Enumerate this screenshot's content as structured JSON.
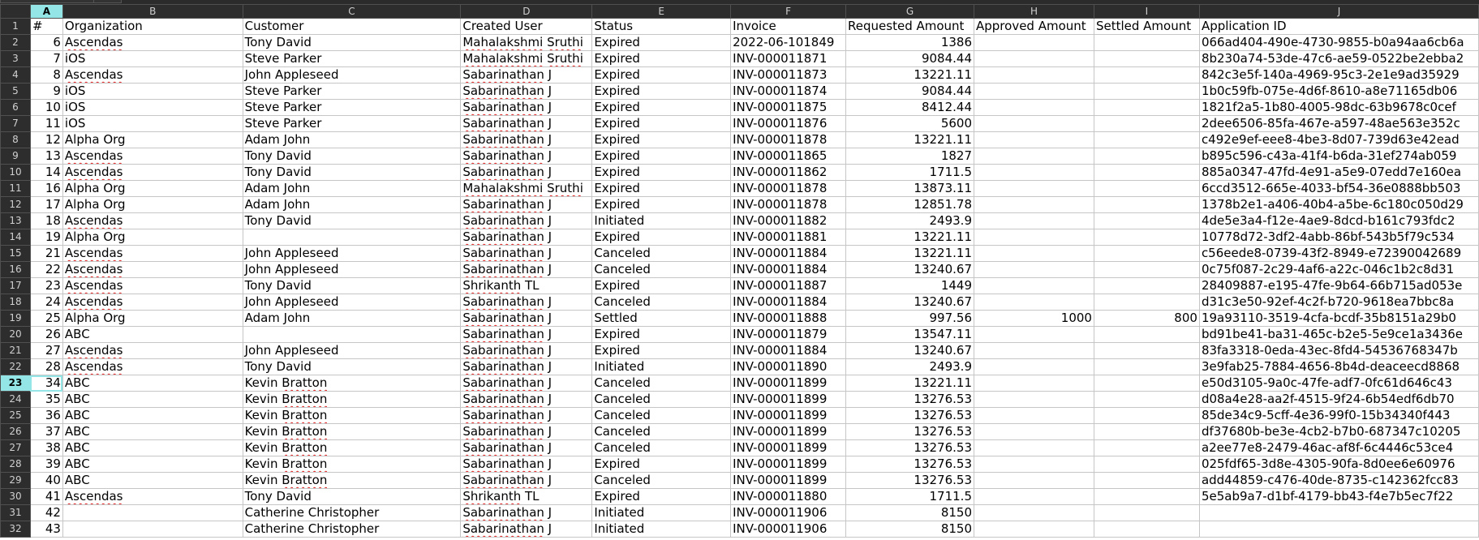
{
  "sheet": {
    "column_letters": [
      "A",
      "B",
      "C",
      "D",
      "E",
      "F",
      "G",
      "H",
      "I",
      "J"
    ],
    "selected_column": "A",
    "selected_row": 23,
    "accent_color": "#94e6e6",
    "headers": [
      "#",
      "Organization",
      "Customer",
      "Created User",
      "Status",
      "Invoice",
      "Requested Amount",
      "Approved Amount",
      "Settled Amount",
      "Application ID"
    ],
    "rows": [
      [
        "6",
        "Ascendas",
        "Tony David",
        "Mahalakshmi Sruthi",
        "Expired",
        "2022-06-101849",
        "1386",
        "",
        "",
        "066ad404-490e-4730-9855-b0a94aa6cb6a"
      ],
      [
        "7",
        "iOS",
        "Steve Parker",
        "Mahalakshmi Sruthi",
        "Expired",
        "INV-000011871",
        "9084.44",
        "",
        "",
        "8b230a74-53de-47c6-ae59-0522be2ebba2"
      ],
      [
        "8",
        "Ascendas",
        "John Appleseed",
        "Sabarinathan J",
        "Expired",
        "INV-000011873",
        "13221.11",
        "",
        "",
        "842c3e5f-140a-4969-95c3-2e1e9ad35929"
      ],
      [
        "9",
        "iOS",
        "Steve Parker",
        "Sabarinathan J",
        "Expired",
        "INV-000011874",
        "9084.44",
        "",
        "",
        "1b0c59fb-075e-4d6f-8610-a8e71165db06"
      ],
      [
        "10",
        "iOS",
        "Steve Parker",
        "Sabarinathan J",
        "Expired",
        "INV-000011875",
        "8412.44",
        "",
        "",
        "1821f2a5-1b80-4005-98dc-63b9678c0cef"
      ],
      [
        "11",
        "iOS",
        "Steve Parker",
        "Sabarinathan J",
        "Expired",
        "INV-000011876",
        "5600",
        "",
        "",
        "2dee6506-85fa-467e-a597-48ae563e352c"
      ],
      [
        "12",
        "Alpha Org",
        "Adam John",
        "Sabarinathan J",
        "Expired",
        "INV-000011878",
        "13221.11",
        "",
        "",
        "c492e9ef-eee8-4be3-8d07-739d63e42ead"
      ],
      [
        "13",
        "Ascendas",
        "Tony David",
        "Sabarinathan J",
        "Expired",
        "INV-000011865",
        "1827",
        "",
        "",
        "b895c596-c43a-41f4-b6da-31ef274ab059"
      ],
      [
        "14",
        "Ascendas",
        "Tony David",
        "Sabarinathan J",
        "Expired",
        "INV-000011862",
        "1711.5",
        "",
        "",
        "885a0347-47fd-4e91-a5e9-07edd7e160ea"
      ],
      [
        "16",
        "Alpha Org",
        "Adam John",
        "Mahalakshmi Sruthi",
        "Expired",
        "INV-000011878",
        "13873.11",
        "",
        "",
        "6ccd3512-665e-4033-bf54-36e0888bb503"
      ],
      [
        "17",
        "Alpha Org",
        "Adam John",
        "Sabarinathan J",
        "Expired",
        "INV-000011878",
        "12851.78",
        "",
        "",
        "1378b2e1-a406-40b4-a5be-6c180c050d29"
      ],
      [
        "18",
        "Ascendas",
        "Tony David",
        "Sabarinathan J",
        "Initiated",
        "INV-000011882",
        "2493.9",
        "",
        "",
        "4de5e3a4-f12e-4ae9-8dcd-b161c793fdc2"
      ],
      [
        "19",
        "Alpha Org",
        "",
        "Sabarinathan J",
        "Expired",
        "INV-000011881",
        "13221.11",
        "",
        "",
        "10778d72-3df2-4abb-86bf-543b5f79c534"
      ],
      [
        "21",
        "Ascendas",
        "John Appleseed",
        "Sabarinathan J",
        "Canceled",
        "INV-000011884",
        "13221.11",
        "",
        "",
        "c56eede8-0739-43f2-8949-e72390042689"
      ],
      [
        "22",
        "Ascendas",
        "John Appleseed",
        "Sabarinathan J",
        "Canceled",
        "INV-000011884",
        "13240.67",
        "",
        "",
        "0c75f087-2c29-4af6-a22c-046c1b2c8d31"
      ],
      [
        "23",
        "Ascendas",
        "Tony David",
        "Shrikanth TL",
        "Expired",
        "INV-000011887",
        "1449",
        "",
        "",
        "28409887-e195-47fe-9b64-66b715ad053e"
      ],
      [
        "24",
        "Ascendas",
        "John Appleseed",
        "Sabarinathan J",
        "Canceled",
        "INV-000011884",
        "13240.67",
        "",
        "",
        "d31c3e50-92ef-4c2f-b720-9618ea7bbc8a"
      ],
      [
        "25",
        "Alpha Org",
        "Adam John",
        "Sabarinathan J",
        "Settled",
        "INV-000011888",
        "997.56",
        "1000",
        "800",
        "19a93110-3519-4cfa-bcdf-35b8151a29b0"
      ],
      [
        "26",
        "ABC",
        "",
        "Sabarinathan J",
        "Expired",
        "INV-000011879",
        "13547.11",
        "",
        "",
        "bd91be41-ba31-465c-b2e5-5e9ce1a3436e"
      ],
      [
        "27",
        "Ascendas",
        "John Appleseed",
        "Sabarinathan J",
        "Expired",
        "INV-000011884",
        "13240.67",
        "",
        "",
        "83fa3318-0eda-43ec-8fd4-54536768347b"
      ],
      [
        "28",
        "Ascendas",
        "Tony David",
        "Sabarinathan J",
        "Initiated",
        "INV-000011890",
        "2493.9",
        "",
        "",
        "3e9fab25-7884-4656-8b4d-deaceecd8868"
      ],
      [
        "34",
        "ABC",
        "Kevin Bratton",
        "Sabarinathan J",
        "Canceled",
        "INV-000011899",
        "13221.11",
        "",
        "",
        "e50d3105-9a0c-47fe-adf7-0fc61d646c43"
      ],
      [
        "35",
        "ABC",
        "Kevin Bratton",
        "Sabarinathan J",
        "Canceled",
        "INV-000011899",
        "13276.53",
        "",
        "",
        "d08a4e28-aa2f-4515-9f24-6b54edf6db70"
      ],
      [
        "36",
        "ABC",
        "Kevin Bratton",
        "Sabarinathan J",
        "Canceled",
        "INV-000011899",
        "13276.53",
        "",
        "",
        "85de34c9-5cff-4e36-99f0-15b34340f443"
      ],
      [
        "37",
        "ABC",
        "Kevin Bratton",
        "Sabarinathan J",
        "Canceled",
        "INV-000011899",
        "13276.53",
        "",
        "",
        "df37680b-be3e-4cb2-b7b0-687347c10205"
      ],
      [
        "38",
        "ABC",
        "Kevin Bratton",
        "Sabarinathan J",
        "Canceled",
        "INV-000011899",
        "13276.53",
        "",
        "",
        "a2ee77e8-2479-46ac-af8f-6c4446c53ce4"
      ],
      [
        "39",
        "ABC",
        "Kevin Bratton",
        "Sabarinathan J",
        "Expired",
        "INV-000011899",
        "13276.53",
        "",
        "",
        "025fdf65-3d8e-4305-90fa-8d0ee6e60976"
      ],
      [
        "40",
        "ABC",
        "Kevin Bratton",
        "Sabarinathan J",
        "Canceled",
        "INV-000011899",
        "13276.53",
        "",
        "",
        "add44859-c476-40de-8735-c142362fcc83"
      ],
      [
        "41",
        "Ascendas",
        "Tony David",
        "Shrikanth TL",
        "Expired",
        "INV-000011880",
        "1711.5",
        "",
        "",
        "5e5ab9a7-d1bf-4179-bb43-f4e7b5ec7f22"
      ],
      [
        "42",
        "",
        "Catherine Christopher",
        "Sabarinathan J",
        "Initiated",
        "INV-000011906",
        "8150",
        "",
        "",
        ""
      ],
      [
        "43",
        "",
        "Catherine Christopher",
        "Sabarinathan J",
        "Initiated",
        "INV-000011906",
        "8150",
        "",
        "",
        ""
      ]
    ]
  }
}
